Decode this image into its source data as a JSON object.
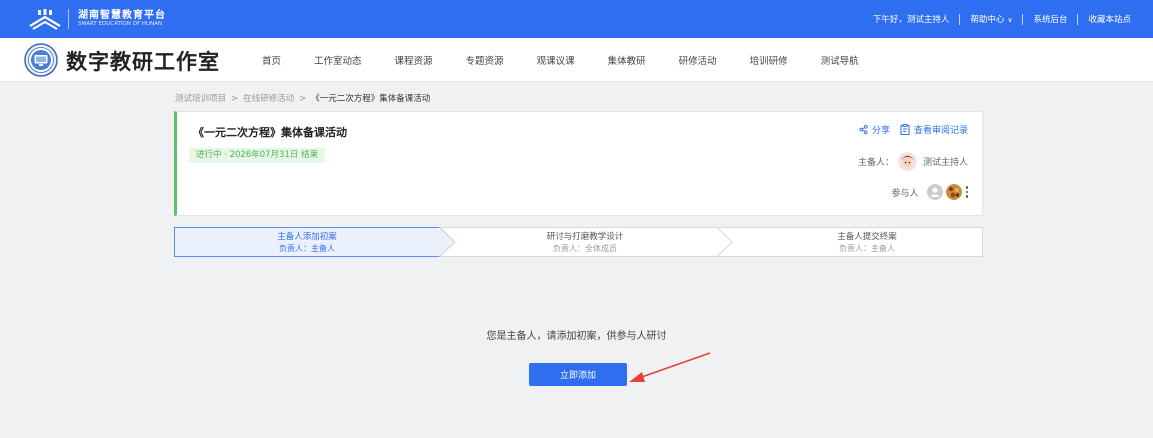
{
  "topbar": {
    "brand_cn": "湖南智慧教育平台",
    "brand_en": "SMART EDUCATION OF HUNAN",
    "greeting": "下午好，测试主持人",
    "help": "帮助中心",
    "admin": "系统后台",
    "bookmark": "收藏本站点",
    "icons": [
      "platform-logo-icon",
      "chevron-down-icon"
    ]
  },
  "header": {
    "studio_title": "数字教研工作室",
    "nav": [
      "首页",
      "工作室动态",
      "课程资源",
      "专题资源",
      "观课议课",
      "集体教研",
      "研修活动",
      "培训研修",
      "测试导航"
    ]
  },
  "breadcrumb": [
    "测试培训项目",
    "在线研修活动",
    "《一元二次方程》集体备课活动"
  ],
  "activity": {
    "title": "《一元二次方程》集体备课活动",
    "status": "进行中 · 2026年07月31日 结束",
    "share": "分享",
    "review_log": "查看审阅记录",
    "host_label": "主备人：",
    "host_name": "测试主持人",
    "participants_label": "参与人"
  },
  "steps": [
    {
      "title": "主备人添加初案",
      "owner": "负责人：主备人",
      "active": true
    },
    {
      "title": "研讨与打磨教学设计",
      "owner": "负责人：全体成员",
      "active": false
    },
    {
      "title": "主备人提交终案",
      "owner": "负责人：主备人",
      "active": false
    }
  ],
  "empty_state": {
    "prompt": "您是主备人，请添加初案，供参与人研讨",
    "button": "立即添加"
  },
  "colors": {
    "primary": "#2f6ef0",
    "status_green": "#4fb35a",
    "card_accent": "#5cc16a",
    "page_bg": "#f0f1f3",
    "arrow_red": "#e8403a"
  }
}
